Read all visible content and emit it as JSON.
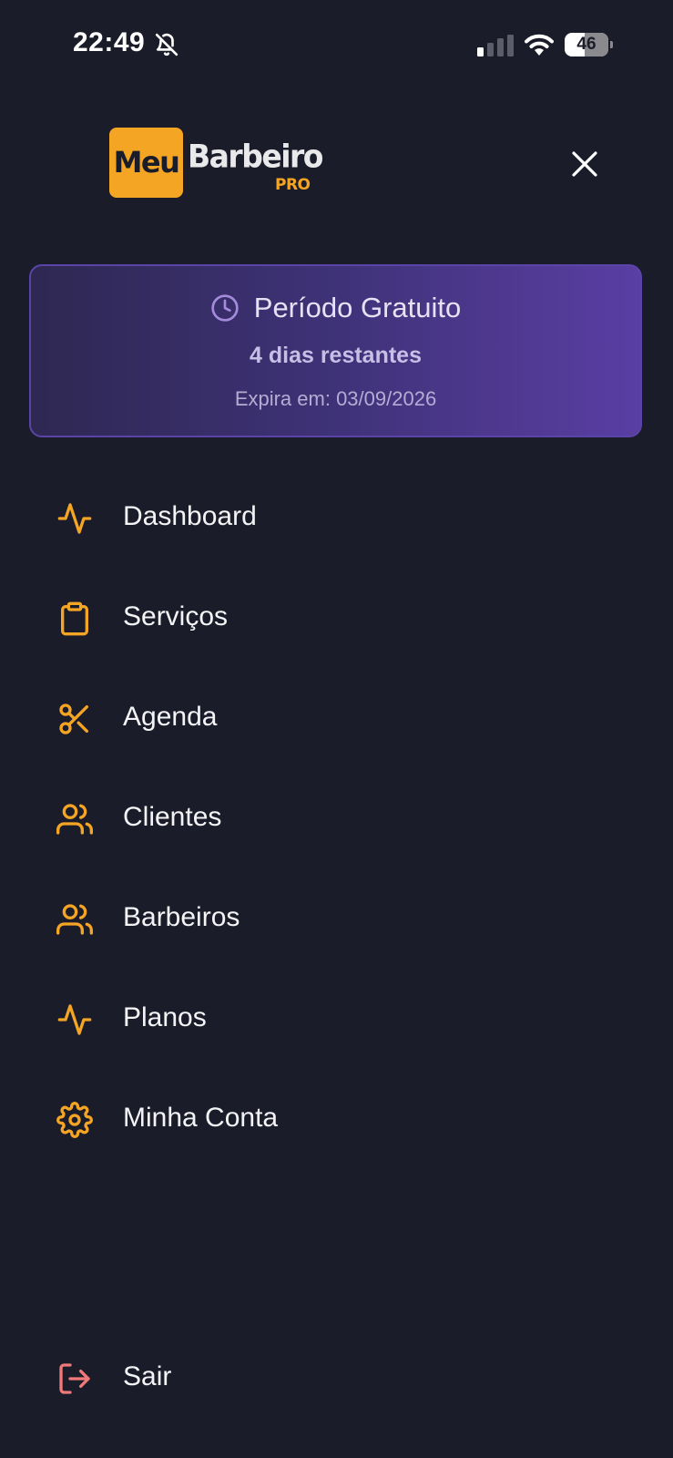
{
  "status_bar": {
    "time": "22:49",
    "battery_level": "46",
    "battery_fraction": 0.46,
    "icons": [
      "bell-slash-icon",
      "cellular-signal-icon",
      "wifi-icon",
      "battery-icon"
    ]
  },
  "header": {
    "logo_primary": "Meu",
    "logo_secondary": "Barbeiro",
    "logo_badge": "PRO",
    "close_icon": "close-icon"
  },
  "trial": {
    "title": "Período Gratuito",
    "days_remaining": "4 dias restantes",
    "expires": "Expira em: 03/09/2026",
    "icon": "clock-icon"
  },
  "menu": {
    "items": [
      {
        "label": "Dashboard",
        "icon": "activity-icon"
      },
      {
        "label": "Serviços",
        "icon": "clipboard-icon"
      },
      {
        "label": "Agenda",
        "icon": "scissors-icon"
      },
      {
        "label": "Clientes",
        "icon": "users-icon"
      },
      {
        "label": "Barbeiros",
        "icon": "users-icon"
      },
      {
        "label": "Planos",
        "icon": "activity-icon"
      },
      {
        "label": "Minha Conta",
        "icon": "gear-icon"
      }
    ],
    "logout": {
      "label": "Sair",
      "icon": "logout-icon"
    }
  },
  "colors": {
    "background": "#1b1c2a",
    "accent": "#f5a524",
    "logout": "#f07a7a",
    "card_start": "#2e2852",
    "card_end": "#5a3ea3"
  }
}
